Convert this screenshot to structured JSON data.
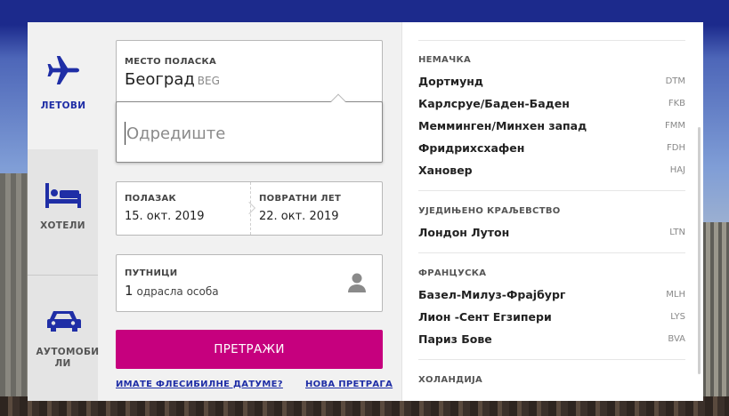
{
  "tabs": [
    {
      "label": "ЛЕТОВИ",
      "icon": "airplane-icon",
      "active": true
    },
    {
      "label": "ХОТЕЛИ",
      "icon": "bed-icon",
      "active": false
    },
    {
      "label": "АУТОМОБИ ЛИ",
      "icon": "car-icon",
      "active": false
    }
  ],
  "origin": {
    "label": "МЕСТО ПОЛАСКА",
    "city": "Београд",
    "code": "BEG"
  },
  "destination": {
    "placeholder": "Одредиште",
    "value": ""
  },
  "dates": {
    "depart_label": "ПОЛАЗАК",
    "depart_value": "15. окт. 2019",
    "return_label": "ПОВРАТНИ ЛЕТ",
    "return_value": "22. окт. 2019"
  },
  "passengers": {
    "label": "ПУТНИЦИ",
    "count": "1",
    "text": "одрасла особа"
  },
  "search_label": "ПРЕТРАЖИ",
  "links": {
    "flexible": "ИМАТЕ ФЛЕСИБИЛНЕ ДАТУМЕ?",
    "new_search": "НОВА ПРЕТРАГА"
  },
  "destinations": [
    {
      "country": "НЕМАЧКА",
      "cities": [
        {
          "name": "Дортмунд",
          "code": "DTM"
        },
        {
          "name": "Карлсруе/Баден-Баден",
          "code": "FKB"
        },
        {
          "name": "Мемминген/Минхен запад",
          "code": "FMM"
        },
        {
          "name": "Фридрихсхафен",
          "code": "FDH"
        },
        {
          "name": "Хановер",
          "code": "HAJ"
        }
      ]
    },
    {
      "country": "УЈЕДИЊЕНО КРАЉЕВСТВО",
      "cities": [
        {
          "name": "Лондон Лутон",
          "code": "LTN"
        }
      ]
    },
    {
      "country": "ФРАНЦУСКА",
      "cities": [
        {
          "name": "Базел-Милуз-Фрајбург",
          "code": "MLH"
        },
        {
          "name": "Лион -Сент Егзипери",
          "code": "LYS"
        },
        {
          "name": "Париз Бове",
          "code": "BVA"
        }
      ]
    },
    {
      "country": "ХОЛАНДИЈА",
      "cities": []
    }
  ],
  "colors": {
    "accent": "#1f2ea6",
    "button": "#c6007e",
    "header": "#1c2a8c"
  }
}
